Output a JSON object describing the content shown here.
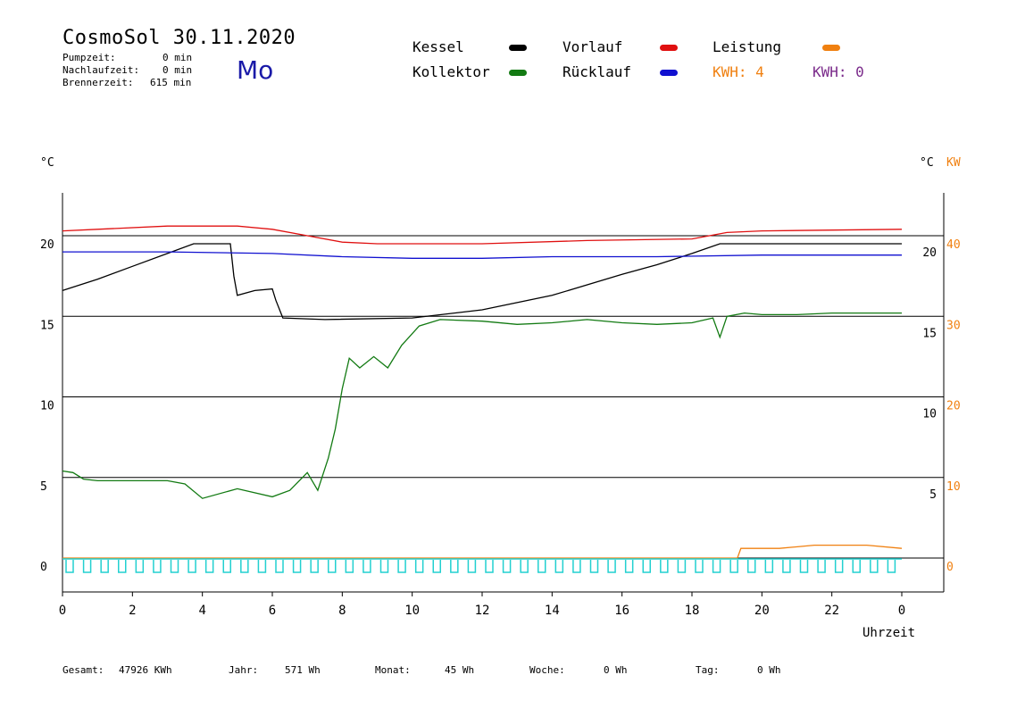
{
  "header": {
    "title": "CosmoSol 30.11.2020",
    "day": "Mo",
    "pumpzeit_label": "Pumpzeit:",
    "pumpzeit_value": "0 min",
    "nachlaufzeit_label": "Nachlaufzeit:",
    "nachlaufzeit_value": "0 min",
    "brennerzeit_label": "Brennerzeit:",
    "brennerzeit_value": "615 min"
  },
  "legend": {
    "kessel": "Kessel",
    "vorlauf": "Vorlauf",
    "leistung": "Leistung",
    "kollektor": "Kollektor",
    "ruecklauf": "Rücklauf",
    "kwh_solar": "KWH: 4",
    "kwh_other": "KWH: 0"
  },
  "colors": {
    "kessel": "#000000",
    "vorlauf": "#e01010",
    "leistung": "#f08010",
    "kollektor": "#127a12",
    "ruecklauf": "#1010d0",
    "pump": "#22d0d0",
    "kwh_other": "#7a2a8a"
  },
  "axes": {
    "left_unit": "°C",
    "right_unit_c": "°C",
    "right_unit_kw": "KW",
    "xlabel": "Uhrzeit"
  },
  "footer": {
    "gesamt_label": "Gesamt:",
    "gesamt_value": "47926 KWh",
    "jahr_label": "Jahr:",
    "jahr_value": "571 Wh",
    "monat_label": "Monat:",
    "monat_value": "45 Wh",
    "woche_label": "Woche:",
    "woche_value": "0 Wh",
    "tag_label": "Tag:",
    "tag_value": "0 Wh"
  },
  "chart_data": {
    "type": "line",
    "xlabel": "Uhrzeit",
    "ylabel": "°C",
    "xlim": [
      0,
      24
    ],
    "ylim": [
      0,
      20
    ],
    "y2lim": [
      0,
      40
    ],
    "grid": true,
    "x_ticks": [
      "0",
      "2",
      "4",
      "6",
      "8",
      "10",
      "12",
      "14",
      "16",
      "18",
      "20",
      "22",
      "0"
    ],
    "y_ticks_left": [
      "0",
      "5",
      "10",
      "15",
      "20"
    ],
    "y_ticks_right_c": [
      "5",
      "10",
      "15",
      "20"
    ],
    "y_ticks_right_kw": [
      "0",
      "10",
      "20",
      "30",
      "40"
    ],
    "series": [
      {
        "name": "Kessel",
        "x": [
          0,
          1,
          2,
          3,
          3.75,
          4.8,
          4.9,
          5.0,
          5.5,
          6.0,
          6.1,
          6.3,
          7.5,
          10,
          12,
          14,
          16,
          17,
          18,
          18.8,
          19.5,
          24
        ],
        "y": [
          16.6,
          17.3,
          18.1,
          18.9,
          19.5,
          19.5,
          17.5,
          16.3,
          16.6,
          16.7,
          16.0,
          14.9,
          14.8,
          14.9,
          15.4,
          16.3,
          17.6,
          18.2,
          18.9,
          19.5,
          19.5,
          19.5
        ]
      },
      {
        "name": "Vorlauf",
        "x": [
          0,
          1,
          3,
          5,
          6,
          7,
          8,
          9,
          12,
          15,
          18,
          19,
          20,
          24
        ],
        "y": [
          20.3,
          20.4,
          20.6,
          20.6,
          20.4,
          20.0,
          19.6,
          19.5,
          19.5,
          19.7,
          19.8,
          20.2,
          20.3,
          20.4
        ]
      },
      {
        "name": "Rücklauf",
        "x": [
          0,
          3,
          6,
          8,
          10,
          12,
          14,
          17,
          20,
          24
        ],
        "y": [
          19.0,
          19.0,
          18.9,
          18.7,
          18.6,
          18.6,
          18.7,
          18.7,
          18.8,
          18.8
        ]
      },
      {
        "name": "Kollektor",
        "x": [
          0,
          0.3,
          0.6,
          1,
          2,
          3,
          3.5,
          4,
          5,
          6,
          6.5,
          7,
          7.3,
          7.6,
          7.8,
          8.0,
          8.2,
          8.5,
          8.9,
          9.3,
          9.7,
          10.2,
          10.8,
          12,
          13,
          14,
          15,
          16,
          17,
          18,
          18.6,
          18.8,
          19,
          19.5,
          20,
          21,
          22,
          23,
          24
        ],
        "y": [
          5.4,
          5.3,
          4.9,
          4.8,
          4.8,
          4.8,
          4.6,
          3.7,
          4.3,
          3.8,
          4.2,
          5.3,
          4.2,
          6.2,
          8.0,
          10.5,
          12.4,
          11.8,
          12.5,
          11.8,
          13.2,
          14.4,
          14.8,
          14.7,
          14.5,
          14.6,
          14.8,
          14.6,
          14.5,
          14.6,
          14.9,
          13.7,
          15.0,
          15.2,
          15.1,
          15.1,
          15.2,
          15.2,
          15.2
        ]
      },
      {
        "name": "Leistung",
        "x": [
          0,
          19.3,
          19.4,
          20.5,
          21.5,
          23,
          24
        ],
        "y": [
          0,
          0,
          0.6,
          0.6,
          0.8,
          0.8,
          0.6
        ]
      }
    ],
    "pump_pulses_per_hour": 2
  }
}
